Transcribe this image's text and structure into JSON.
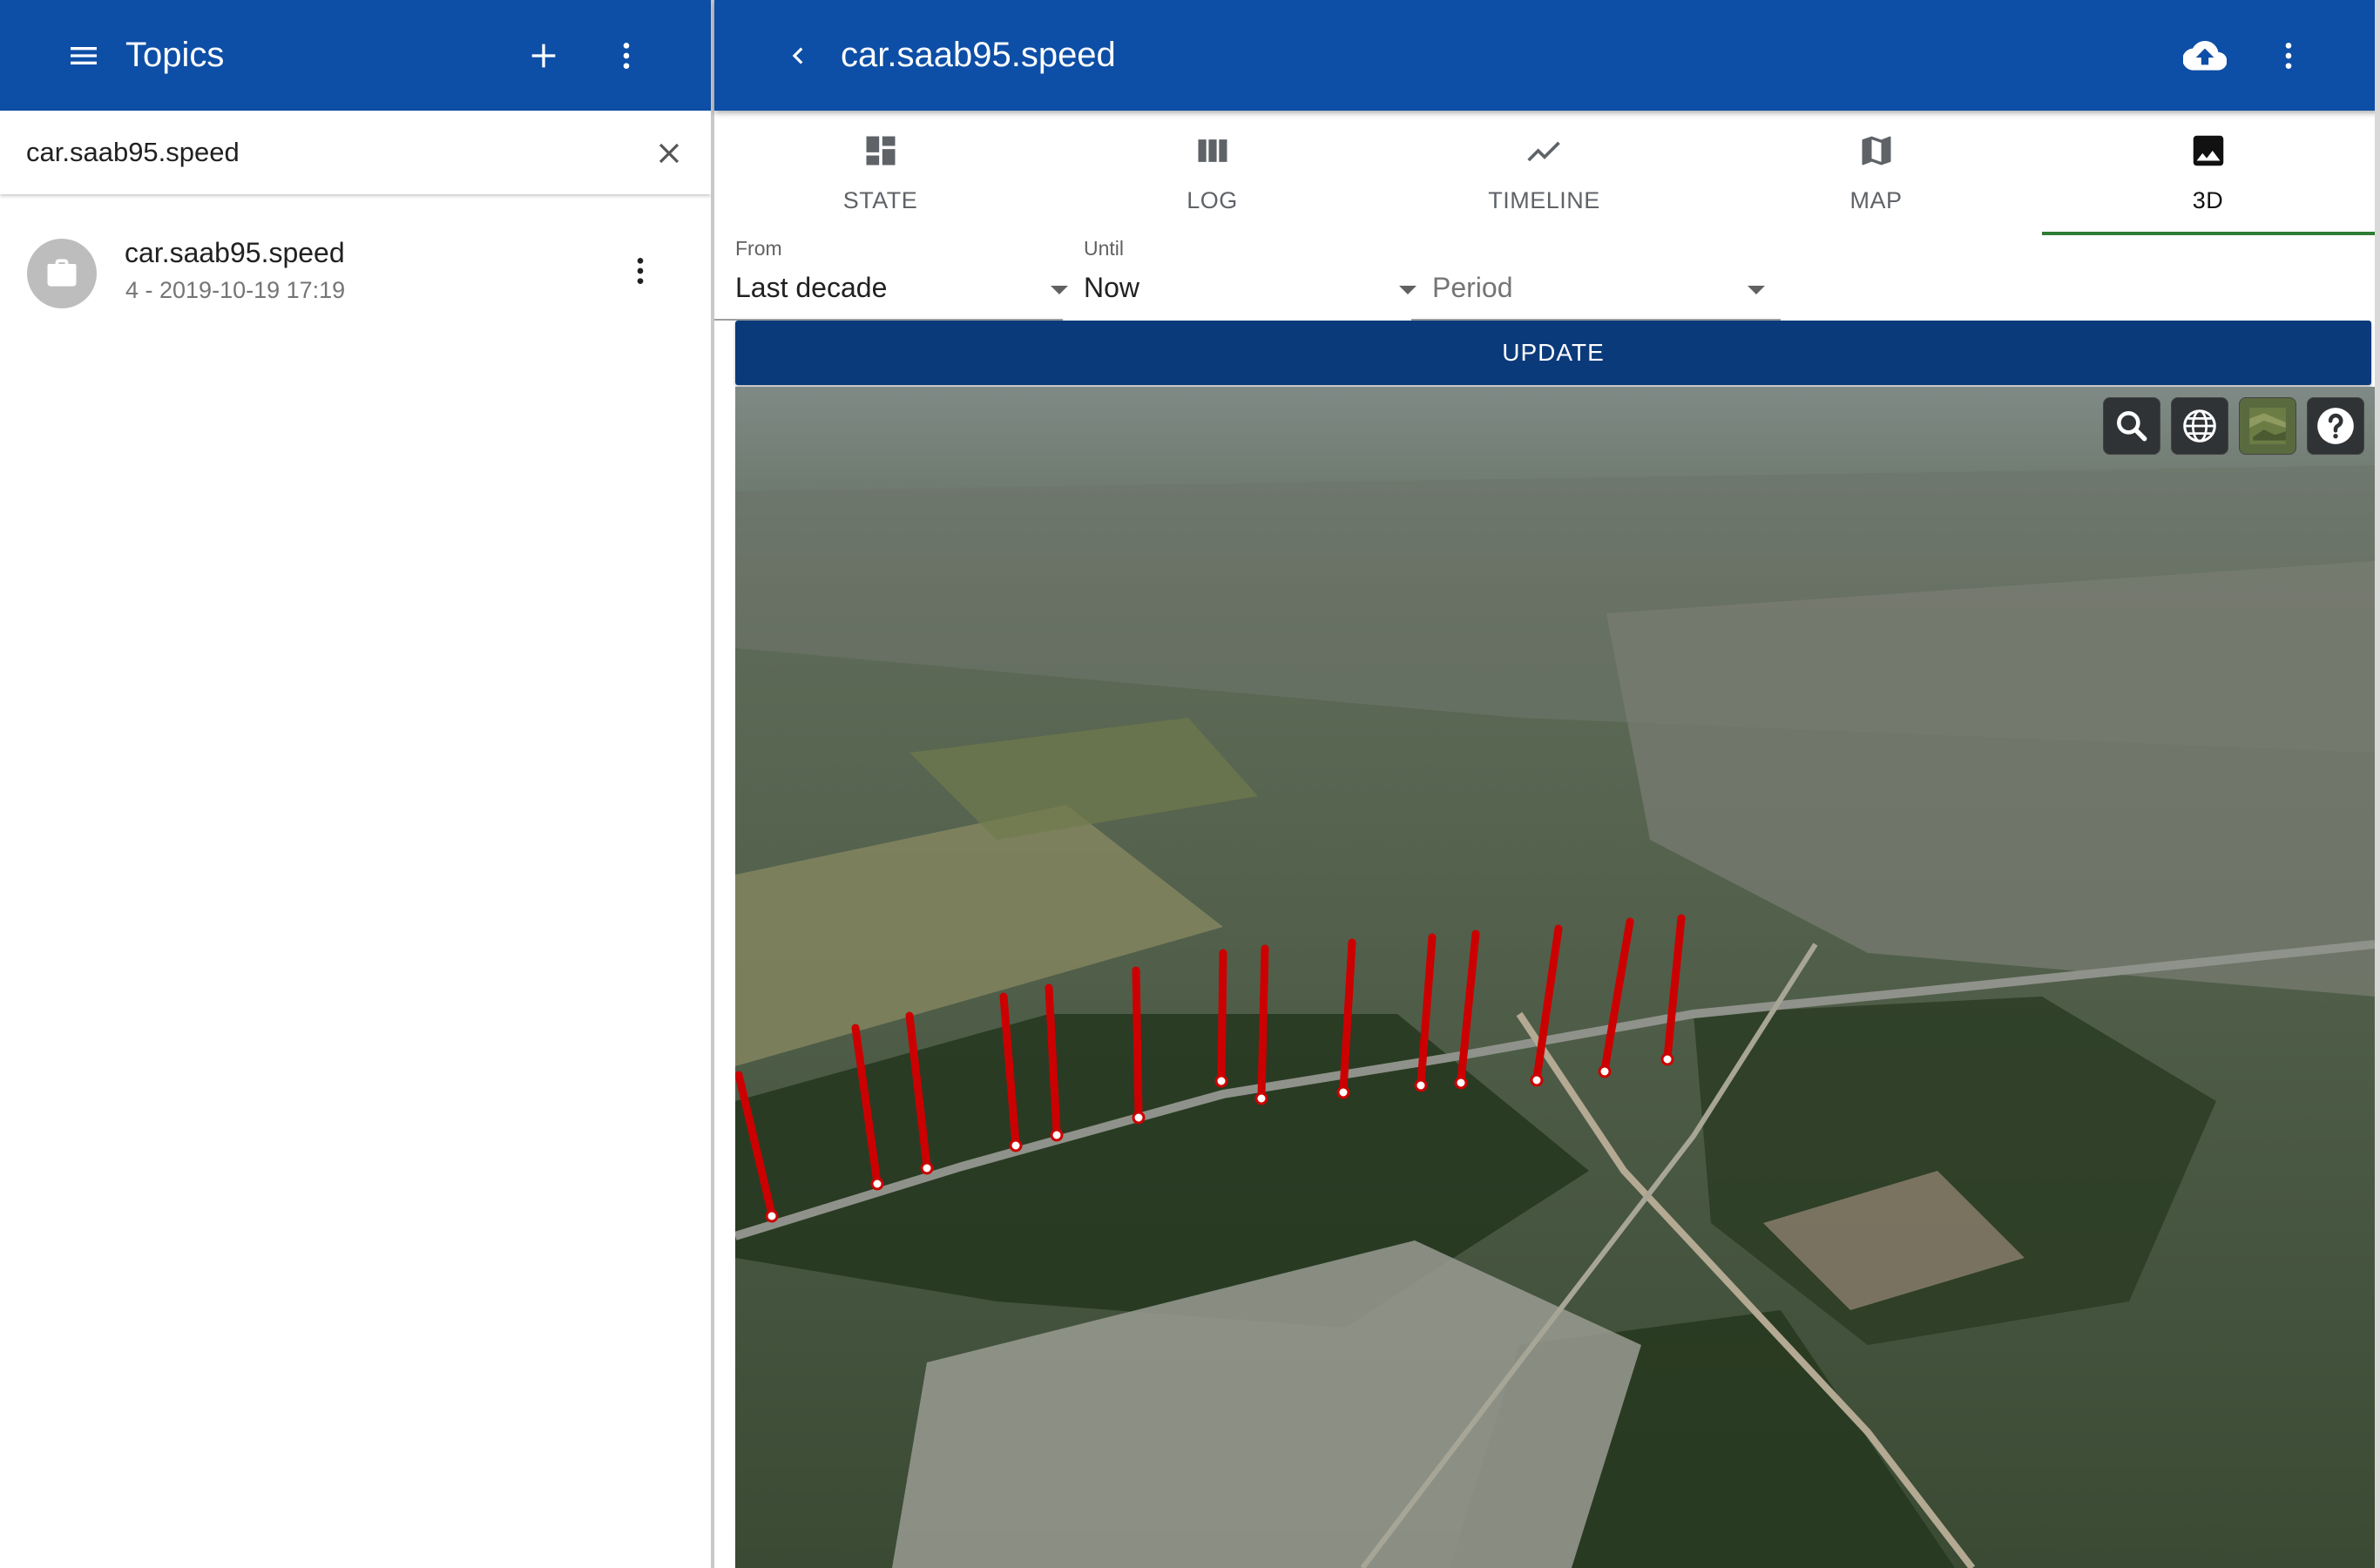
{
  "left_panel": {
    "title": "Topics",
    "search": {
      "value": "car.saab95.speed",
      "placeholder": ""
    },
    "items": [
      {
        "title": "car.saab95.speed",
        "subtitle": "4 - 2019-10-19 17:19"
      }
    ]
  },
  "right_panel": {
    "title": "car.saab95.speed",
    "tabs": [
      {
        "label": "STATE",
        "icon": "dashboard-icon"
      },
      {
        "label": "LOG",
        "icon": "view-column-icon"
      },
      {
        "label": "TIMELINE",
        "icon": "timeline-icon"
      },
      {
        "label": "MAP",
        "icon": "map-icon"
      },
      {
        "label": "3D",
        "icon": "image-icon"
      }
    ],
    "active_tab": "3D",
    "filters": {
      "from": {
        "label": "From",
        "value": "Last decade"
      },
      "until": {
        "label": "Until",
        "value": "Now"
      },
      "period": {
        "placeholder": "Period"
      }
    },
    "update_label": "UPDATE",
    "viewer_tools": [
      "search-icon",
      "globe-icon",
      "imagery-layer-icon",
      "help-icon"
    ]
  },
  "colors": {
    "app_bar": "#0d4ea6",
    "update_button": "#0b3a7a",
    "tab_indicator": "#2e7d32",
    "marker": "#cc0000"
  }
}
